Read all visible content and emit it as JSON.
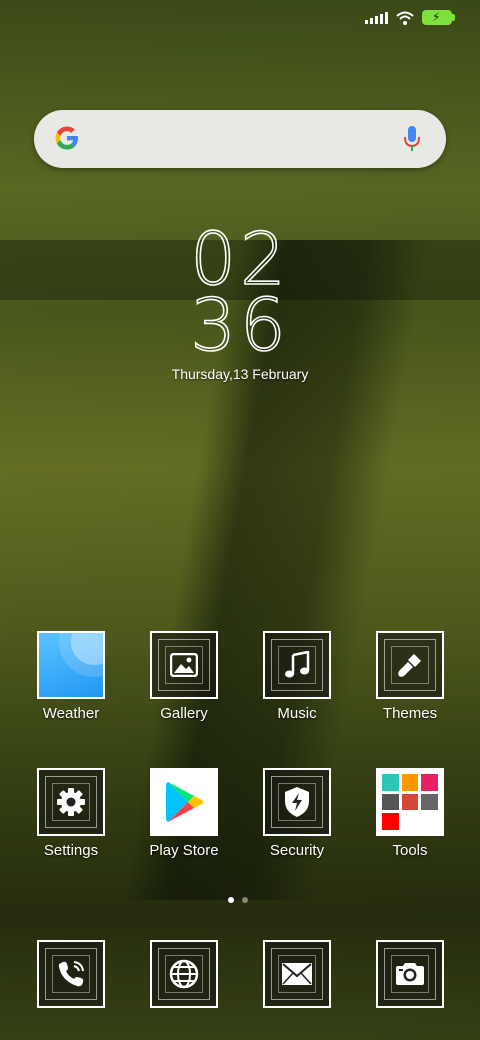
{
  "status_bar": {
    "signal": "signal-icon",
    "wifi": "wifi-icon",
    "battery": "battery-charging-icon",
    "battery_color": "#7ee03a"
  },
  "search_bar": {
    "logo": "google-logo-icon",
    "voice": "microphone-icon"
  },
  "clock": {
    "hours": "02",
    "minutes": "36",
    "date": "Thursday,13 February"
  },
  "apps_row1": [
    {
      "label": "Weather",
      "icon": "weather-icon"
    },
    {
      "label": "Gallery",
      "icon": "gallery-icon"
    },
    {
      "label": "Music",
      "icon": "music-icon"
    },
    {
      "label": "Themes",
      "icon": "themes-icon"
    }
  ],
  "apps_row2": [
    {
      "label": "Settings",
      "icon": "settings-icon"
    },
    {
      "label": "Play Store",
      "icon": "play-store-icon"
    },
    {
      "label": "Security",
      "icon": "security-icon"
    },
    {
      "label": "Tools",
      "icon": "tools-folder-icon"
    }
  ],
  "page_indicator": {
    "pages": 2,
    "current": 1
  },
  "dock": [
    {
      "icon": "phone-icon"
    },
    {
      "icon": "browser-icon"
    },
    {
      "icon": "messages-icon"
    },
    {
      "icon": "camera-icon"
    }
  ]
}
